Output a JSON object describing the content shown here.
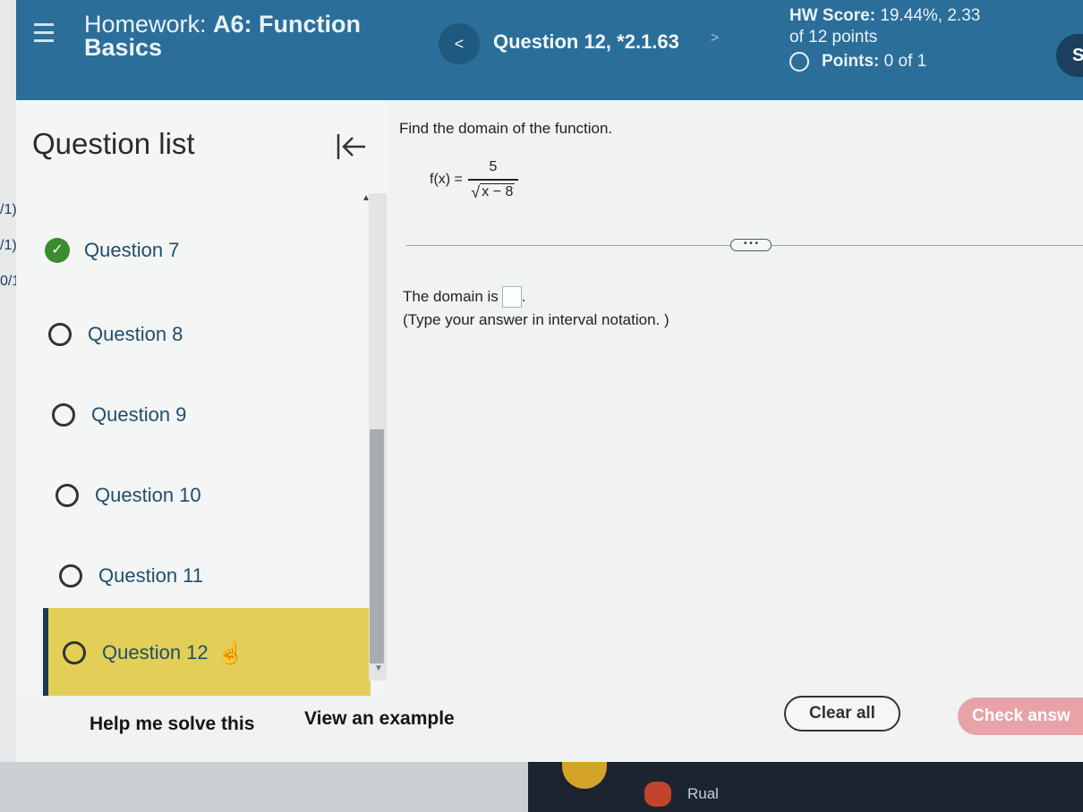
{
  "header": {
    "hw_title_prefix": "Homework:",
    "hw_title_bold": "A6: Function",
    "hw_title_line2": "Basics",
    "prev_label": "<",
    "question_title": "Question 12, *2.1.63",
    "next_label": ">",
    "hw_score_label": "HW Score:",
    "hw_score_value": "19.44%, 2.33",
    "hw_score_line2": "of 12 points",
    "points_label": "Points:",
    "points_value": "0 of 1",
    "save_label": "S"
  },
  "edge_fragments": [
    "/1)",
    "/1)",
    "0/1"
  ],
  "sidebar": {
    "title": "Question list",
    "items": [
      {
        "label": "Question 7",
        "status": "correct"
      },
      {
        "label": "Question 8",
        "status": "unanswered"
      },
      {
        "label": "Question 9",
        "status": "unanswered"
      },
      {
        "label": "Question 10",
        "status": "unanswered"
      },
      {
        "label": "Question 11",
        "status": "unanswered"
      },
      {
        "label": "Question 12",
        "status": "current"
      }
    ]
  },
  "question": {
    "prompt": "Find the domain of the function.",
    "function_lhs": "f(x) =",
    "numerator": "5",
    "radicand": "x − 8",
    "more_label": "• • •",
    "answer_prefix": "The domain is",
    "answer_suffix": ".",
    "answer_value": "",
    "hint": "(Type your answer in interval notation. )"
  },
  "actions": {
    "help_label": "Help me solve this",
    "example_label": "View an example",
    "clear_label": "Clear all",
    "check_label": "Check answ"
  },
  "taskbar": {
    "label": "Rual"
  },
  "colors": {
    "header_bg": "#2b6e99",
    "selected_bg": "#e3cf57",
    "check_bg": "#e7a3a8",
    "correct_green": "#3a8c2c"
  }
}
